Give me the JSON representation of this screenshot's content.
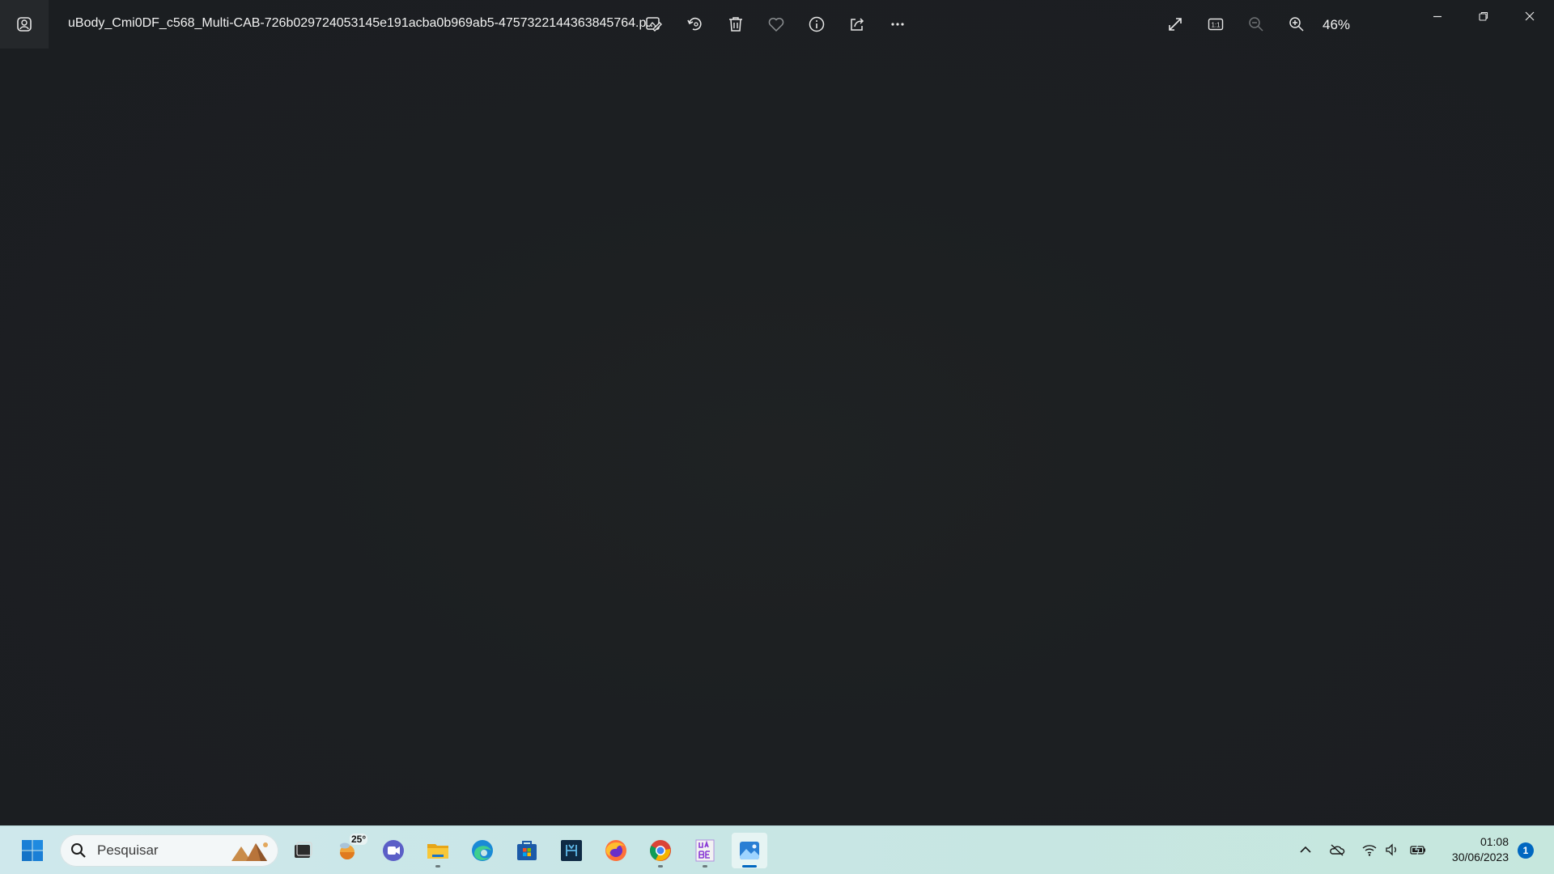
{
  "viewer": {
    "filename": "uBody_Cmi0DF_c568_Multi-CAB-726b029724053145e191acba0b969ab5-4757322144363845764.p...",
    "zoom_level": "46%",
    "toolbar": [
      {
        "name": "edit-image-icon"
      },
      {
        "name": "rotate-icon"
      },
      {
        "name": "delete-icon"
      },
      {
        "name": "favorite-icon"
      },
      {
        "name": "info-icon"
      },
      {
        "name": "share-icon"
      },
      {
        "name": "more-options-icon"
      }
    ],
    "view_controls": [
      {
        "name": "fullscreen-icon"
      },
      {
        "name": "actual-size-icon",
        "label": "1:1"
      },
      {
        "name": "zoom-out-icon"
      },
      {
        "name": "zoom-in-icon"
      }
    ],
    "window_controls": [
      "minimize-icon",
      "restore-icon",
      "close-icon"
    ]
  },
  "taskbar": {
    "search_placeholder": "Pesquisar",
    "weather_temp": "25°",
    "pinned": [
      "start-icon",
      "task-view-icon",
      "weather-icon",
      "meet-icon",
      "file-explorer-icon",
      "edge-icon",
      "store-icon",
      "terminal-app-icon",
      "firefox-icon",
      "chrome-icon",
      "uabe-icon",
      "photos-icon"
    ],
    "tray": [
      "chevron-up-icon",
      "onedrive-offline-icon",
      "wifi-icon",
      "volume-icon",
      "battery-icon"
    ],
    "time": "01:08",
    "date": "30/06/2023",
    "notification_count": "1"
  },
  "colors": {
    "viewer_bg": "#1c1f22",
    "taskbar_bg": "#c8e6e6",
    "accent": "#0067c0"
  }
}
